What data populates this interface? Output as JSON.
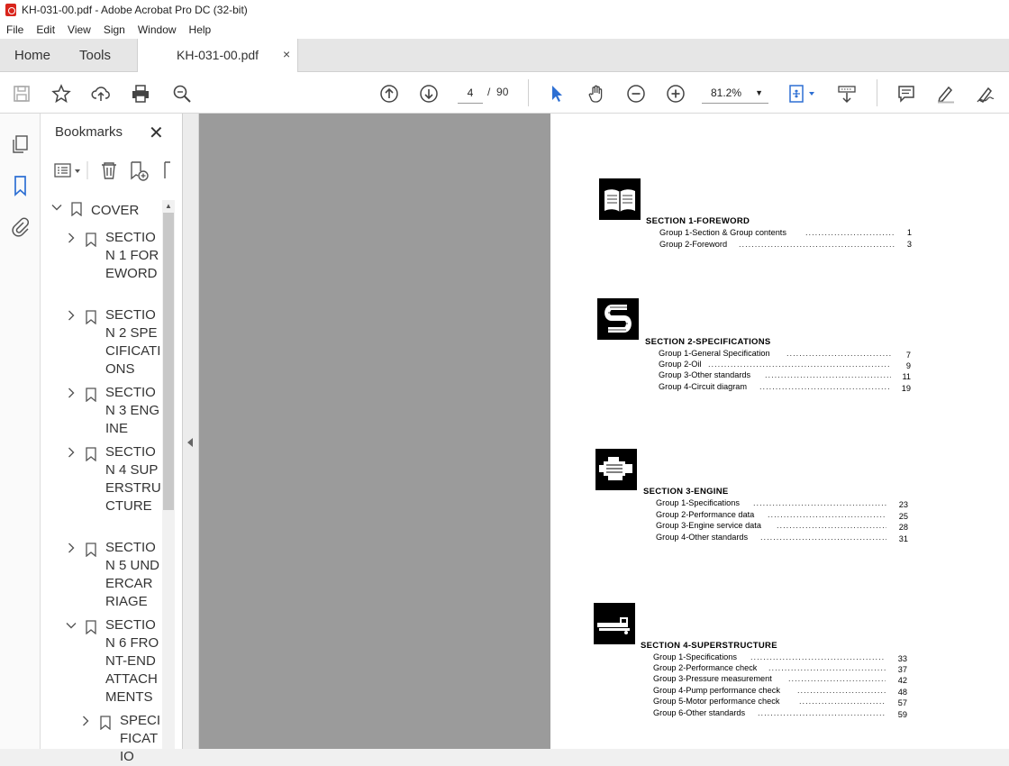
{
  "window": {
    "title": "KH-031-00.pdf - Adobe Acrobat Pro DC (32-bit)"
  },
  "menu": [
    "File",
    "Edit",
    "View",
    "Sign",
    "Window",
    "Help"
  ],
  "tabs": {
    "home": "Home",
    "tools": "Tools",
    "document": "KH-031-00.pdf",
    "close": "×"
  },
  "toolbar": {
    "current_page": "4",
    "page_sep": "/",
    "total_pages": "90",
    "zoom": "81.2%"
  },
  "bookmarks": {
    "title": "Bookmarks",
    "close": "✕",
    "items": [
      {
        "label": "COVER",
        "expanded": true
      },
      {
        "label": "SECTION 1 FOREWORD"
      },
      {
        "label": "SECTION 2 SPECIFICATIONS"
      },
      {
        "label": "SECTION 3 ENGINE"
      },
      {
        "label": "SECTION 4 SUPERSTRUCTURE"
      },
      {
        "label": "SECTION 5 UNDERCARRIAGE"
      },
      {
        "label": "SECTION 6 FRONT-END ATTACHMENTS",
        "expanded": true
      },
      {
        "label": "SPECIFICATIO"
      }
    ]
  },
  "page": {
    "sections": [
      {
        "title": "SECTION  1-FOREWORD",
        "icon": "book-icon",
        "groups": [
          {
            "name": "Group 1-Section & Group contents",
            "page": "1"
          },
          {
            "name": "Group 2-Foreword",
            "page": "3"
          }
        ]
      },
      {
        "title": "SECTION  2-SPECIFICATIONS",
        "icon": "s-logo-icon",
        "groups": [
          {
            "name": "Group 1-General Specification",
            "page": "7"
          },
          {
            "name": "Group 2-Oil",
            "page": "9"
          },
          {
            "name": "Group 3-Other standards",
            "page": "11"
          },
          {
            "name": "Group 4-Circuit diagram",
            "page": "19"
          }
        ]
      },
      {
        "title": "SECTION  3-ENGINE",
        "icon": "engine-icon",
        "groups": [
          {
            "name": "Group 1-Specifications",
            "page": "23"
          },
          {
            "name": "Group 2-Performance data",
            "page": "25"
          },
          {
            "name": "Group 3-Engine service data",
            "page": "28"
          },
          {
            "name": "Group 4-Other standards",
            "page": "31"
          }
        ]
      },
      {
        "title": "SECTION  4-SUPERSTRUCTURE",
        "icon": "excavator-icon",
        "groups": [
          {
            "name": "Group 1-Specifications",
            "page": "33"
          },
          {
            "name": "Group 2-Performance check",
            "page": "37"
          },
          {
            "name": "Group 3-Pressure measurement",
            "page": "42"
          },
          {
            "name": "Group 4-Pump performance check",
            "page": "48"
          },
          {
            "name": "Group 5-Motor performance check",
            "page": "57"
          },
          {
            "name": "Group 6-Other standards",
            "page": "59"
          }
        ]
      }
    ]
  }
}
